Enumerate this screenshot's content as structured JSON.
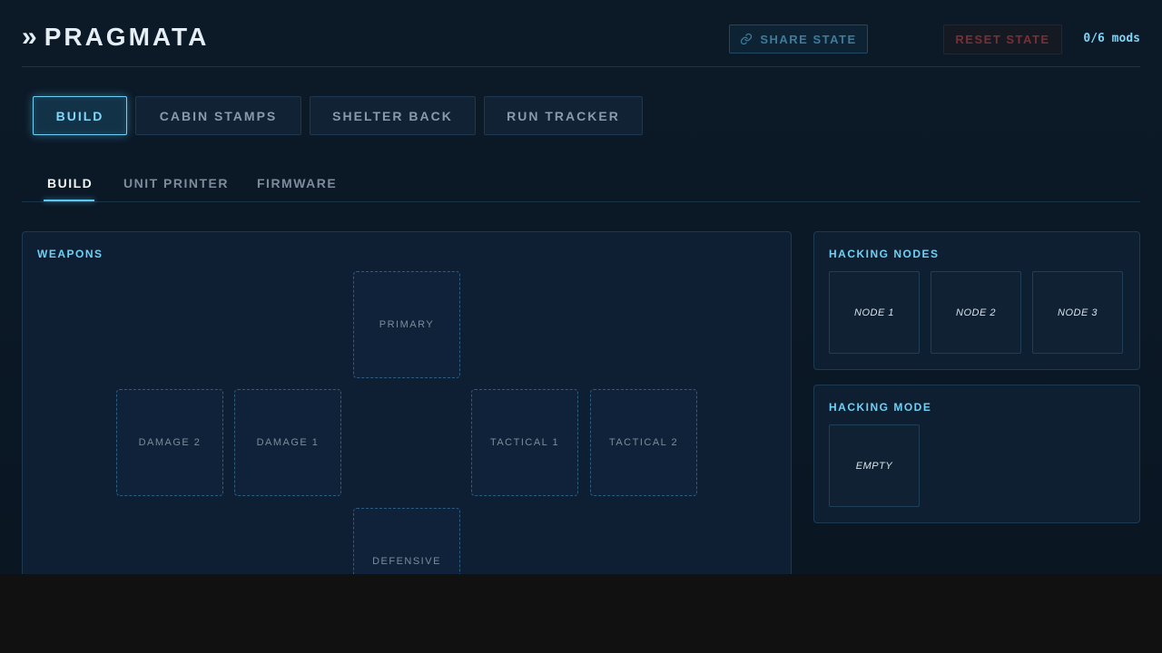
{
  "header": {
    "brand_glyph": "»",
    "title": "PRAGMATA",
    "share_label": "SHARE STATE",
    "reset_label": "RESET STATE",
    "mods_count": "0/6 mods"
  },
  "primary_tabs": [
    {
      "label": "BUILD",
      "active": true
    },
    {
      "label": "CABIN STAMPS",
      "active": false
    },
    {
      "label": "SHELTER BACK",
      "active": false
    },
    {
      "label": "RUN TRACKER",
      "active": false
    }
  ],
  "secondary_tabs": [
    {
      "label": "BUILD",
      "active": true
    },
    {
      "label": "UNIT PRINTER",
      "active": false
    },
    {
      "label": "FIRMWARE",
      "active": false
    }
  ],
  "weapons": {
    "title": "WEAPONS",
    "slots": {
      "primary": "PRIMARY",
      "damage_2": "DAMAGE 2",
      "damage_1": "DAMAGE 1",
      "tactical_1": "TACTICAL 1",
      "tactical_2": "TACTICAL 2",
      "defensive": "DEFENSIVE"
    }
  },
  "hacking_nodes": {
    "title": "HACKING NODES",
    "nodes": [
      "NODE 1",
      "NODE 2",
      "NODE 3"
    ]
  },
  "hacking_mode": {
    "title": "HACKING MODE",
    "value": "EMPTY"
  },
  "colors": {
    "accent": "#6fd0f5",
    "background": "#0b1826",
    "danger": "#7a2e35"
  },
  "icons": {
    "share": "link-icon",
    "brand": "double-chevron-icon"
  }
}
